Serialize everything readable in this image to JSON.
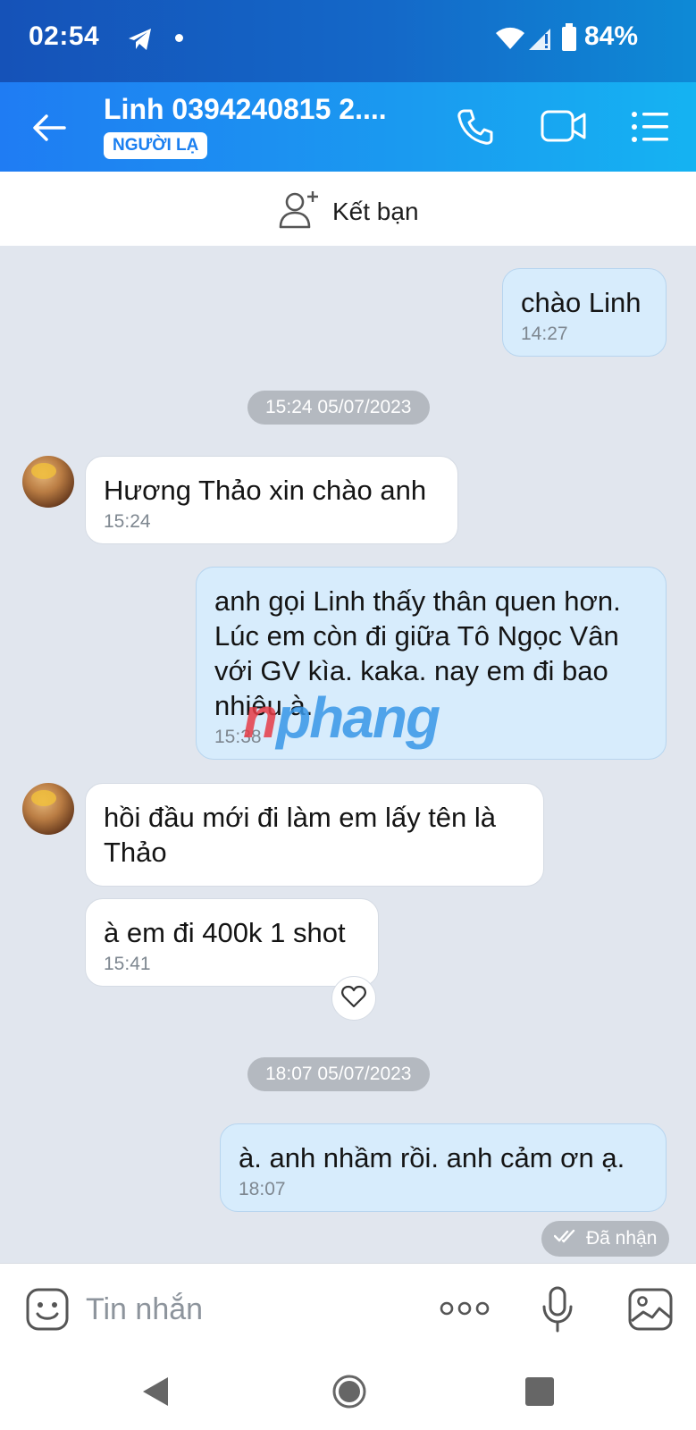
{
  "status_bar": {
    "time": "02:54",
    "battery": "84%"
  },
  "header": {
    "name": "Linh 0394240815 2....",
    "badge": "NGƯỜI LẠ"
  },
  "friend_bar": {
    "label": "Kết bạn"
  },
  "messages": [
    {
      "text": "chào Linh",
      "time": "14:27"
    },
    {
      "text": "Hương Thảo xin chào anh",
      "time": "15:24"
    },
    {
      "text": "anh gọi Linh thấy thân quen hơn. Lúc em còn đi giữa Tô Ngọc Vân với GV kìa. kaka. nay em đi bao nhiêu à.",
      "time": "15:38"
    },
    {
      "text": "hồi đầu mới đi làm em lấy tên là Thảo"
    },
    {
      "text": "à em đi 400k 1 shot",
      "time": "15:41"
    },
    {
      "text": "à. anh nhầm rồi. anh cảm ơn ạ.",
      "time": "18:07"
    }
  ],
  "date_separators": [
    "15:24 05/07/2023",
    "18:07 05/07/2023"
  ],
  "status": {
    "received": "Đã nhận"
  },
  "watermark": {
    "part1": "n",
    "part2": "phang"
  },
  "input": {
    "placeholder": "Tin nhắn"
  }
}
